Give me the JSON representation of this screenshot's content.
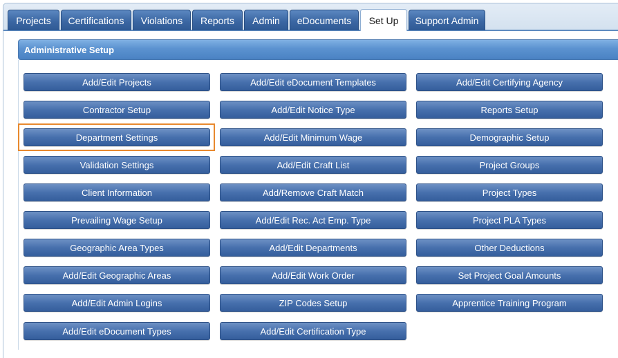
{
  "tabs": [
    {
      "label": "Projects"
    },
    {
      "label": "Certifications"
    },
    {
      "label": "Violations"
    },
    {
      "label": "Reports"
    },
    {
      "label": "Admin"
    },
    {
      "label": "eDocuments"
    },
    {
      "label": "Set Up",
      "active": true
    },
    {
      "label": "Support Admin"
    }
  ],
  "panel": {
    "title": "Administrative Setup",
    "columns": [
      [
        "Add/Edit Projects",
        "Contractor Setup",
        "Department Settings",
        "Validation Settings",
        "Client Information",
        "Prevailing Wage Setup",
        "Geographic Area Types",
        "Add/Edit Geographic Areas",
        "Add/Edit Admin Logins",
        "Add/Edit eDocument Types"
      ],
      [
        "Add/Edit eDocument Templates",
        "Add/Edit Notice Type",
        "Add/Edit Minimum Wage",
        "Add/Edit Craft List",
        "Add/Remove Craft Match",
        "Add/Edit Rec. Act Emp. Type",
        "Add/Edit Departments",
        "Add/Edit Work Order",
        "ZIP Codes Setup",
        "Add/Edit Certification Type"
      ],
      [
        "Add/Edit Certifying Agency",
        "Reports Setup",
        "Demographic Setup",
        "Project Groups",
        "Project Types",
        "Project PLA Types",
        "Other Deductions",
        "Set Project Goal Amounts",
        "Apprentice Training Program"
      ]
    ],
    "highlighted_button": "Department Settings"
  },
  "colors": {
    "tab_blue": "#3b67a3",
    "button_blue": "#4770ad",
    "header_blue": "#5b92d0",
    "highlight_orange": "#e8892e"
  }
}
